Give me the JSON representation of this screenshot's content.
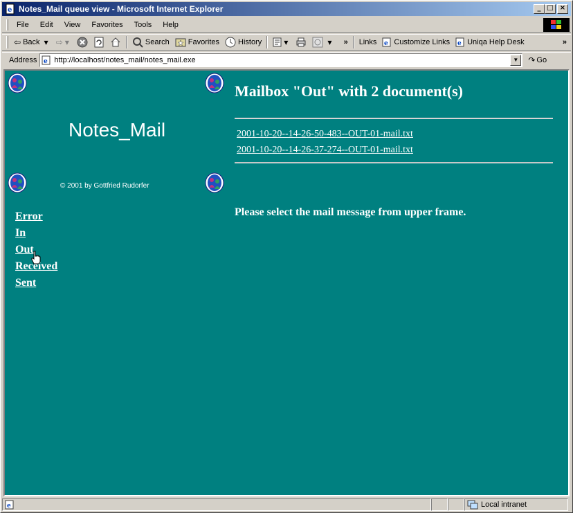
{
  "window": {
    "title": "Notes_Mail queue view - Microsoft Internet Explorer",
    "minimize": "_",
    "maximize": "□",
    "close": "×"
  },
  "menu": {
    "items": [
      "File",
      "Edit",
      "View",
      "Favorites",
      "Tools",
      "Help"
    ]
  },
  "toolbar": {
    "back": "Back",
    "search": "Search",
    "favorites": "Favorites",
    "history": "History",
    "overflow": "»",
    "links_label": "Links",
    "links": [
      "Customize Links",
      "Uniqa Help Desk"
    ]
  },
  "address": {
    "label": "Address",
    "url": "http://localhost/notes_mail/notes_mail.exe",
    "go": "Go"
  },
  "left_frame": {
    "title": "Notes_Mail",
    "copyright": "© 2001 by Gottfried Rudorfer",
    "nav": [
      "Error",
      "In",
      "Out",
      "Received",
      "Sent"
    ]
  },
  "right_frame": {
    "mailbox_title": "Mailbox \"Out\" with 2 document(s)",
    "documents": [
      "2001-10-20--14-26-50-483--OUT-01-mail.txt",
      "2001-10-20--14-26-37-274--OUT-01-mail.txt"
    ],
    "select_message": "Please select the mail message from upper frame."
  },
  "status": {
    "zone": "Local intranet"
  },
  "colors": {
    "page_background": "#008080",
    "titlebar_start": "#0a246a",
    "titlebar_end": "#a6caf0"
  }
}
